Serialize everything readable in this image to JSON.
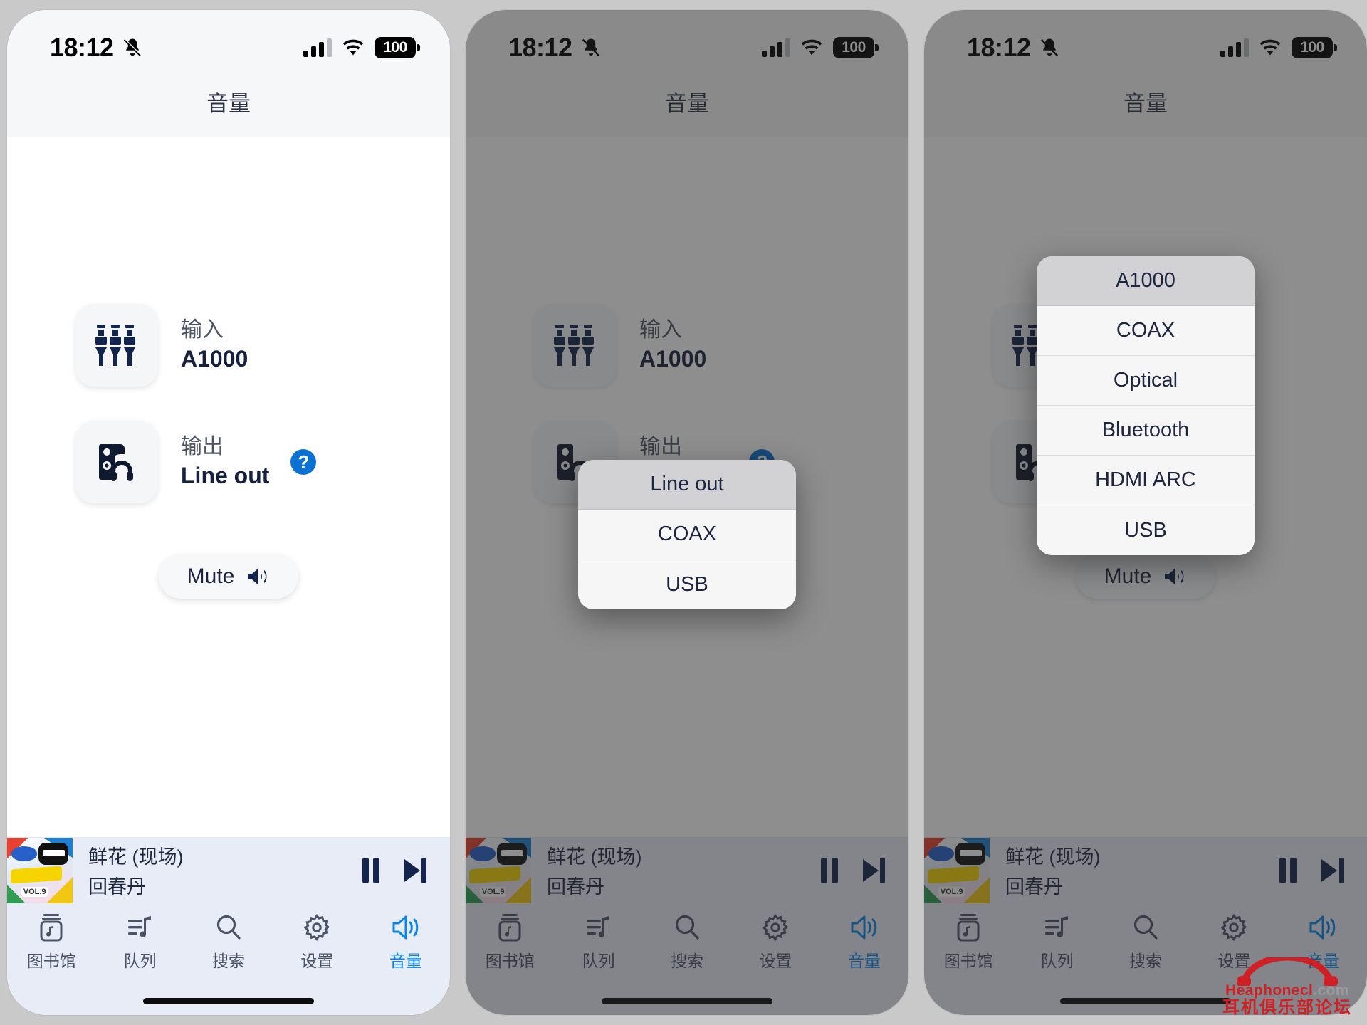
{
  "status_bar": {
    "time": "18:12",
    "battery_level": "100",
    "icons": [
      "bell-slash-icon",
      "cellular-signal-icon",
      "wifi-icon",
      "battery-icon"
    ]
  },
  "nav": {
    "title": "音量"
  },
  "colors": {
    "accent_blue": "#0b84e8",
    "help_blue": "#0b72d4",
    "navy": "#15203f",
    "label_gray": "#4c5468",
    "tabbar_bg": "#e8ecf6",
    "popup_bg": "#f6f6f6",
    "popup_selected_bg": "#d2d2d4",
    "dim_overlay": "rgba(38,38,38,0.52)",
    "watermark_red": "#cf2026"
  },
  "settings": {
    "input": {
      "label": "输入",
      "value": "A1000",
      "icon": "audio-jacks-icon"
    },
    "output": {
      "label": "输出",
      "value": "Line out",
      "icon": "device-headphones-icon",
      "help_label": "?"
    },
    "mute_button": {
      "label": "Mute",
      "icon": "speaker-wave-icon"
    }
  },
  "now_playing": {
    "title": "鲜花 (现场)",
    "artist": "回春丹",
    "artwork_text": "VOL.9",
    "controls": [
      {
        "name": "pause-button",
        "icon": "pause-icon"
      },
      {
        "name": "next-track-button",
        "icon": "next-track-icon"
      }
    ]
  },
  "tabs": [
    {
      "label": "图书馆",
      "icon": "library-icon",
      "active": false
    },
    {
      "label": "队列",
      "icon": "queue-icon",
      "active": false
    },
    {
      "label": "搜索",
      "icon": "search-icon",
      "active": false
    },
    {
      "label": "设置",
      "icon": "gear-icon",
      "active": false
    },
    {
      "label": "音量",
      "icon": "speaker-wave-icon",
      "active": true
    }
  ],
  "panels": [
    {
      "name": "base-state",
      "dimmed": false,
      "popup": null
    },
    {
      "name": "output-picker-open",
      "dimmed": true,
      "popup": {
        "name": "output-source-menu",
        "selected": "Line out",
        "options": [
          "Line out",
          "COAX",
          "USB"
        ]
      }
    },
    {
      "name": "input-picker-open",
      "dimmed": true,
      "popup": {
        "name": "input-source-menu",
        "selected": "A1000",
        "options": [
          "A1000",
          "COAX",
          "Optical",
          "Bluetooth",
          "HDMI ARC",
          "USB"
        ]
      }
    }
  ],
  "watermark": {
    "brand_prefix": "Hea",
    "brand_mid": "phonecl",
    "brand_suffix": ".com",
    "subtitle": "耳机俱乐部论坛"
  }
}
